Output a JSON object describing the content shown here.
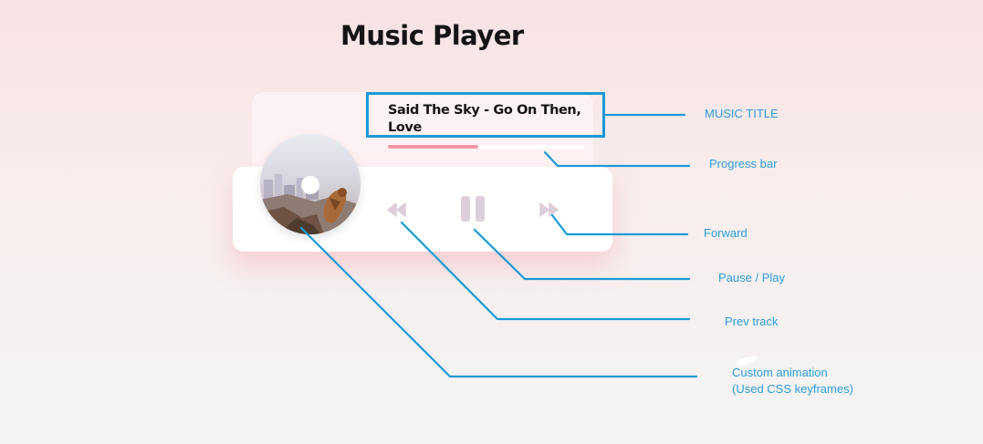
{
  "page": {
    "title": "Music Player"
  },
  "player": {
    "track_title": "Said The Sky - Go On Then, Love",
    "progress": 0.46,
    "colors": {
      "progress_fill": "#f397a8",
      "progress_track": "#ffffff",
      "card": "#ffffff",
      "info_card": "#fdf2f3",
      "controls": "#dccfd9"
    },
    "controls": {
      "prev_icon": "rewind-icon",
      "play_pause_icon": "pause-icon",
      "next_icon": "fast-forward-icon"
    }
  },
  "annotations": {
    "accent": "#1a9ad7",
    "music_title": "MUSIC TITLE",
    "progress_bar": "Progress bar",
    "forward": "Forward",
    "pause_play": "Pause / Play",
    "prev_track": "Prev track",
    "custom_animation_line1": "Custom animation",
    "custom_animation_line2": "(Used CSS keyframes)"
  }
}
